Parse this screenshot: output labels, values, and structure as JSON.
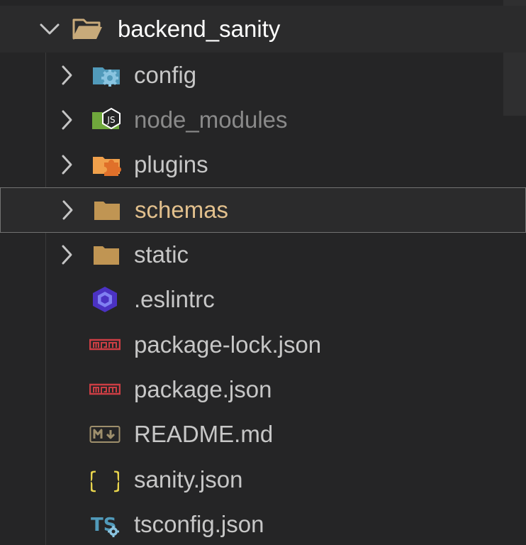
{
  "explorer": {
    "root": {
      "label": "backend_sanity",
      "icon": "open-folder-icon",
      "expanded": true
    },
    "items": [
      {
        "label": "config",
        "type": "folder",
        "icon": "config-folder-icon",
        "color": "#519aba"
      },
      {
        "label": "node_modules",
        "type": "folder",
        "icon": "node-modules-folder-icon",
        "color": "#8bc34a",
        "dimmed": true
      },
      {
        "label": "plugins",
        "type": "folder",
        "icon": "plugins-folder-icon",
        "color": "#e88b3a"
      },
      {
        "label": "schemas",
        "type": "folder",
        "icon": "folder-icon",
        "color": "#e2c08d",
        "selected": true
      },
      {
        "label": "static",
        "type": "folder",
        "icon": "folder-icon",
        "color": "#c09553"
      },
      {
        "label": ".eslintrc",
        "type": "file",
        "icon": "eslint-icon",
        "color": "#4b32c3"
      },
      {
        "label": "package-lock.json",
        "type": "file",
        "icon": "npm-icon",
        "color": "#cc3e44"
      },
      {
        "label": "package.json",
        "type": "file",
        "icon": "npm-icon",
        "color": "#cc3e44"
      },
      {
        "label": "README.md",
        "type": "file",
        "icon": "markdown-icon",
        "color": "#9e8f6c"
      },
      {
        "label": "sanity.json",
        "type": "file",
        "icon": "json-braces-icon",
        "color": "#cbcb41"
      },
      {
        "label": "tsconfig.json",
        "type": "file",
        "icon": "tsconfig-icon",
        "color": "#519aba"
      }
    ]
  }
}
